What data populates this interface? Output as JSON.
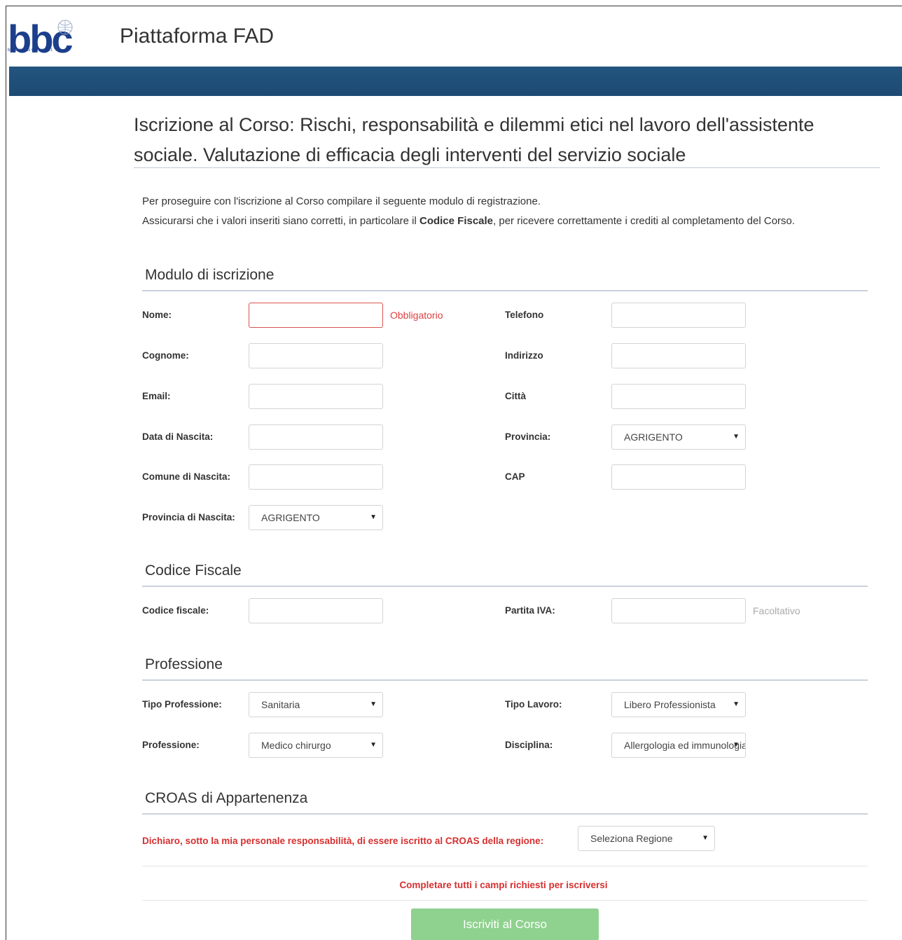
{
  "header": {
    "logo_text": "bbc",
    "logo_subtext": "by Business Center s.r.l.",
    "app_title": "Piattaforma FAD"
  },
  "page": {
    "title": "Iscrizione al Corso: Rischi, responsabilità e dilemmi etici nel lavoro dell'assistente sociale. Valutazione di efficacia degli interventi del servizio sociale",
    "intro_line1": "Per proseguire con l'iscrizione al Corso compilare il seguente modulo di registrazione.",
    "intro_line2_pre": "Assicurarsi che i valori inseriti siano corretti, in particolare il ",
    "intro_line2_bold": "Codice Fiscale",
    "intro_line2_post": ", per ricevere correttamente i crediti al completamento del Corso."
  },
  "sections": {
    "modulo": "Modulo di iscrizione",
    "codice_fiscale": "Codice Fiscale",
    "professione": "Professione",
    "croas": "CROAS di Appartenenza"
  },
  "fields": {
    "nome": {
      "label": "Nome:",
      "value": "",
      "hint": "Obbligatorio"
    },
    "cognome": {
      "label": "Cognome:",
      "value": ""
    },
    "email": {
      "label": "Email:",
      "value": ""
    },
    "data_nascita": {
      "label": "Data di Nascita:",
      "value": ""
    },
    "comune_nascita": {
      "label": "Comune di Nascita:",
      "value": ""
    },
    "provincia_nascita": {
      "label": "Provincia di Nascita:",
      "selected": "AGRIGENTO"
    },
    "telefono": {
      "label": "Telefono",
      "value": ""
    },
    "indirizzo": {
      "label": "Indirizzo",
      "value": ""
    },
    "citta": {
      "label": "Città",
      "value": ""
    },
    "provincia": {
      "label": "Provincia:",
      "selected": "AGRIGENTO"
    },
    "cap": {
      "label": "CAP",
      "value": ""
    },
    "codice_fiscale": {
      "label": "Codice fiscale:",
      "value": ""
    },
    "partita_iva": {
      "label": "Partita IVA:",
      "value": "",
      "hint": "Facoltativo"
    },
    "tipo_professione": {
      "label": "Tipo Professione:",
      "selected": "Sanitaria"
    },
    "professione": {
      "label": "Professione:",
      "selected": "Medico chirurgo"
    },
    "tipo_lavoro": {
      "label": "Tipo Lavoro:",
      "selected": "Libero Professionista"
    },
    "disciplina": {
      "label": "Disciplina:",
      "selected": "Allergologia ed immunologia"
    },
    "regione": {
      "selected": "Seleziona Regione"
    }
  },
  "croas": {
    "declaration": "Dichiaro, sotto la mia personale responsabilità, di essere iscritto al CROAS della regione:"
  },
  "footer": {
    "warning": "Completare tutti i campi richiesti per iscriversi",
    "submit_label": "Iscriviti al Corso"
  },
  "colors": {
    "banner": "#1f4f79",
    "error": "#d62f2f",
    "submit": "#8fd18f"
  }
}
